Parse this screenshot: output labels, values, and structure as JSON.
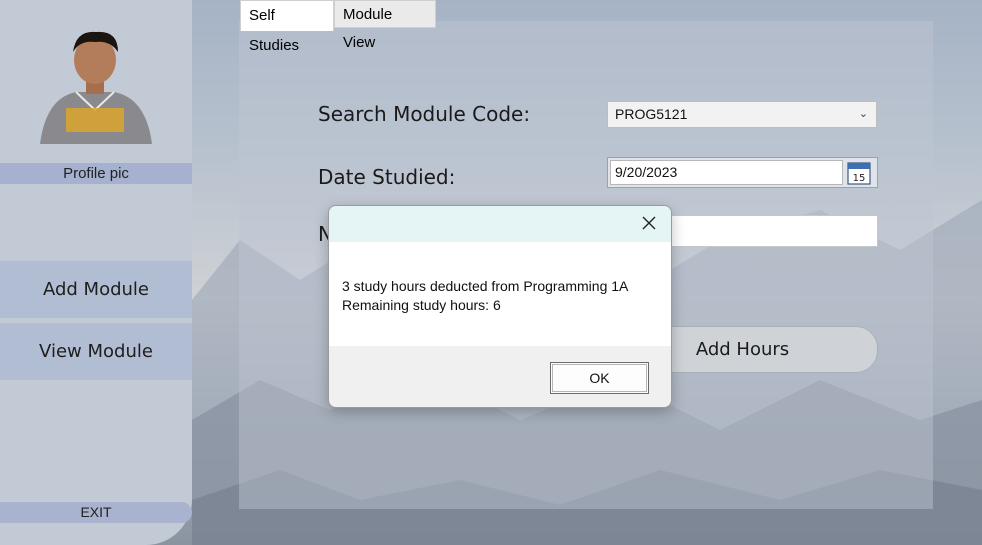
{
  "sidebar": {
    "profile_label": "Profile pic",
    "items": [
      {
        "label": "Add Module"
      },
      {
        "label": "View Module"
      }
    ],
    "exit_label": "EXIT"
  },
  "tabs": [
    {
      "label": "Self Studies",
      "active": true
    },
    {
      "label": "Module View",
      "active": false
    }
  ],
  "form": {
    "search_label": "Search Module Code:",
    "module_code": "PROG5121",
    "date_label": "Date Studied:",
    "date_value": "9/20/2023",
    "calendar_day": "15",
    "hours_label_partial": "N",
    "add_hours_label": "Add Hours"
  },
  "dialog": {
    "line1": "3 study hours deducted from Programming 1A",
    "line2": "Remaining study hours: 6",
    "ok_label": "OK"
  },
  "colors": {
    "sidebar_bg": "#c2cad6",
    "label_bar": "#a5b1cf",
    "side_button": "#b1bdd2",
    "dialog_title_bg": "#e5f5f5"
  }
}
